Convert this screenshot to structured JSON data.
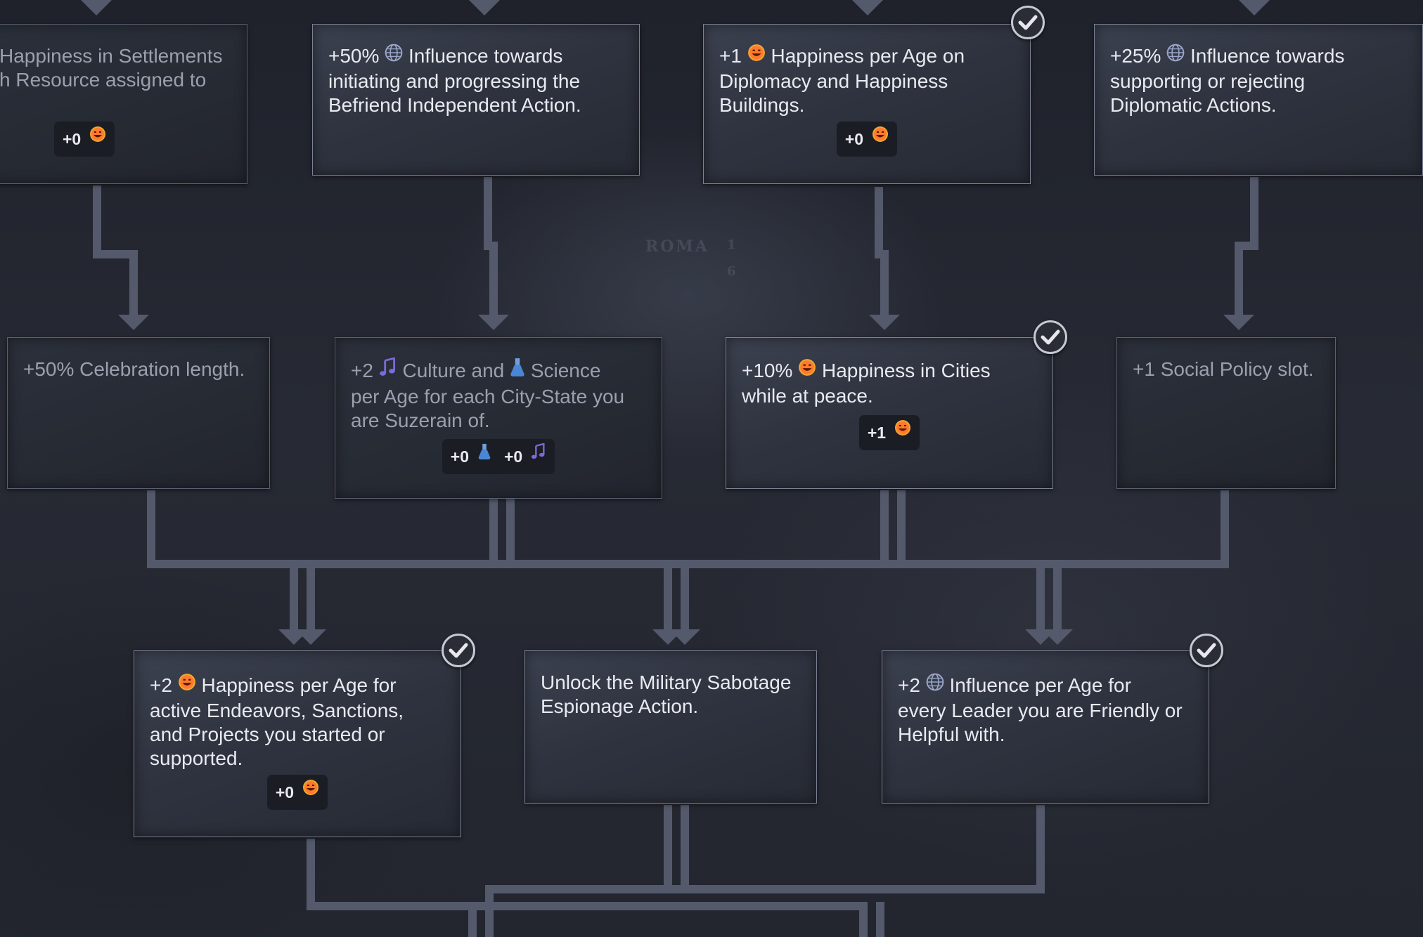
{
  "colors": {
    "connector": "#545a6c",
    "node_border": "#7b8294",
    "node_text": "#e8eaf0",
    "dim_text": "#9aa0ae",
    "badge_bg": "#1b1d24",
    "check": "#c5c9d3"
  },
  "background_label": {
    "city_name": "ROMA",
    "side_top": "1",
    "side_bottom": "6"
  },
  "nodes": {
    "n1": {
      "desc_pre": "Happiness in Settlements\nh Resource assigned to",
      "badge_value": "+0",
      "badge_icon": "happiness-icon",
      "completed": false
    },
    "n2": {
      "prefix": "+50%",
      "icon": "influence-icon",
      "desc": " Influence towards\ninitiating and progressing the\nBefriend Independent Action.",
      "completed": false
    },
    "n3": {
      "prefix": "+1",
      "icon": "happiness-icon",
      "desc": " Happiness per Age on\nDiplomacy and Happiness\nBuildings.",
      "badge_value": "+0",
      "badge_icon": "happiness-icon",
      "completed": true
    },
    "n4": {
      "prefix": "+25%",
      "icon": "influence-icon",
      "desc": " Influence towards\nsupporting or rejecting\nDiplomatic Actions.",
      "completed": false
    },
    "n5": {
      "desc": "+50% Celebration length.",
      "completed": false
    },
    "n6": {
      "prefix": "+2",
      "icon": "culture-icon",
      "mid": " Culture and ",
      "icon2": "science-icon",
      "desc": " Science\nper Age for each City-State you\nare Suzerain of.",
      "badge_value": "+0",
      "badge_icon": "science-icon",
      "badge2_value": "+0",
      "badge2_icon": "culture-icon",
      "completed": false
    },
    "n7": {
      "prefix": "+10%",
      "icon": "happiness-icon",
      "desc": " Happiness in Cities\nwhile at peace.",
      "badge_value": "+1",
      "badge_icon": "happiness-icon",
      "completed": true
    },
    "n8": {
      "desc": "+1 Social Policy slot.",
      "completed": false
    },
    "n9": {
      "prefix": "+2",
      "icon": "happiness-icon",
      "desc": " Happiness per Age for\nactive Endeavors, Sanctions,\nand Projects you started or\nsupported.",
      "badge_value": "+0",
      "badge_icon": "happiness-icon",
      "completed": true
    },
    "n10": {
      "desc": "Unlock the Military Sabotage\nEspionage Action.",
      "completed": false
    },
    "n11": {
      "prefix": "+2",
      "icon": "influence-icon",
      "desc": " Influence per Age for\nevery Leader you are Friendly or\nHelpful with.",
      "completed": true
    }
  }
}
